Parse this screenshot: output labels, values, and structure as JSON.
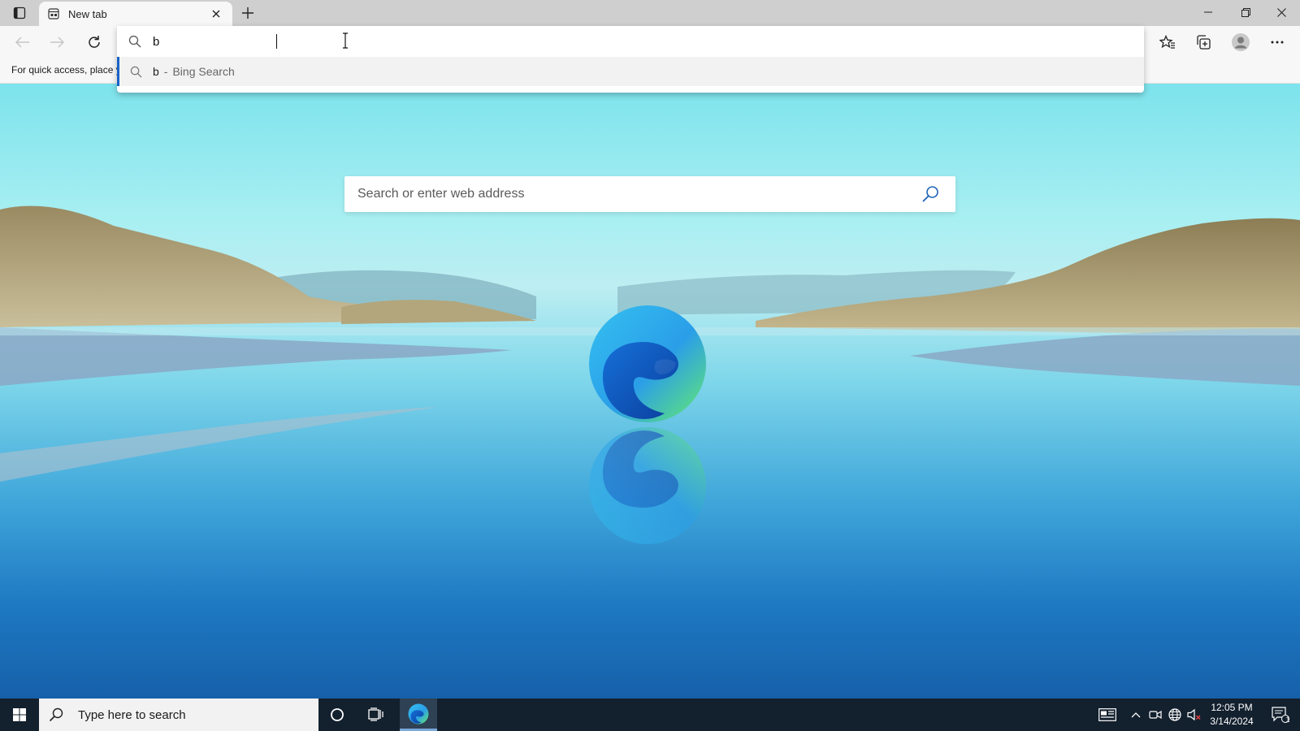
{
  "browser": {
    "tab": {
      "title": "New tab"
    },
    "address_bar": {
      "value": "b"
    },
    "suggestions": [
      {
        "query": "b",
        "separator": "-",
        "engine": "Bing Search"
      }
    ],
    "favorites_bar": {
      "hint": "For quick access, place y"
    },
    "icons": {
      "tab_actions": "tab-actions-icon",
      "favicon": "new-tab-page-icon",
      "close": "close-icon",
      "new_tab": "plus-icon",
      "back": "back-arrow-icon",
      "forward": "forward-arrow-icon",
      "refresh": "refresh-icon",
      "favorites": "favorites-star-icon",
      "collections": "collections-icon",
      "profile": "profile-avatar-icon",
      "more": "more-ellipsis-icon"
    }
  },
  "page": {
    "search_placeholder": "Search or enter web address"
  },
  "taskbar": {
    "search_placeholder": "Type here to search",
    "clock": {
      "time": "12:05 PM",
      "date": "3/14/2024"
    },
    "notification_count": "1",
    "icons": {
      "start": "windows-start-icon",
      "cortana": "cortana-circle-icon",
      "task_view": "task-view-icon",
      "edge": "edge-icon",
      "news": "news-widget-icon",
      "tray_overflow": "chevron-up-icon",
      "meet": "meet-now-icon",
      "network": "network-globe-icon",
      "volume": "volume-muted-icon",
      "notifications": "action-center-icon"
    }
  },
  "colors": {
    "accent": "#1a63c9",
    "taskbar": "#13202e",
    "tab_strip": "#cfcfcf",
    "toolbar": "#f7f7f7"
  }
}
